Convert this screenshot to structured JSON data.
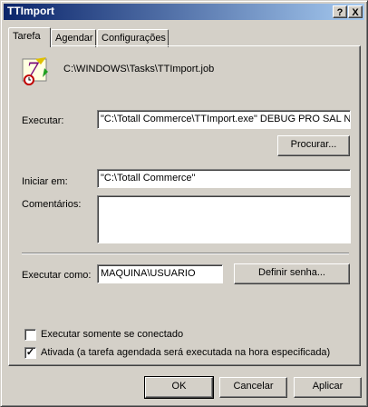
{
  "window": {
    "title": "TTImport",
    "help_label": "?",
    "close_label": "X"
  },
  "tabs": [
    {
      "label": "Tarefa",
      "active": true
    },
    {
      "label": "Agendar",
      "active": false
    },
    {
      "label": "Configurações",
      "active": false
    }
  ],
  "task": {
    "icon": "scheduled-task-icon",
    "path": "C:\\WINDOWS\\Tasks\\TTImport.job",
    "run_label": "Executar:",
    "run_value": "\"C:\\Totall Commerce\\TTImport.exe\" DEBUG PRO SAL N",
    "browse_label": "Procurar...",
    "start_in_label": "Iniciar em:",
    "start_in_value": "\"C:\\Totall Commerce\"",
    "comments_label": "Comentários:",
    "comments_value": "",
    "run_as_label": "Executar como:",
    "run_as_value": "MAQUINA\\USUARIO",
    "set_password_label": "Definir senha...",
    "only_logged_label": "Executar somente se  conectado",
    "only_logged_checked": false,
    "enabled_label": "Ativada (a tarefa agendada será executada na hora especificada)",
    "enabled_checked": true
  },
  "footer": {
    "ok_label": "OK",
    "cancel_label": "Cancelar",
    "apply_label": "Aplicar"
  }
}
